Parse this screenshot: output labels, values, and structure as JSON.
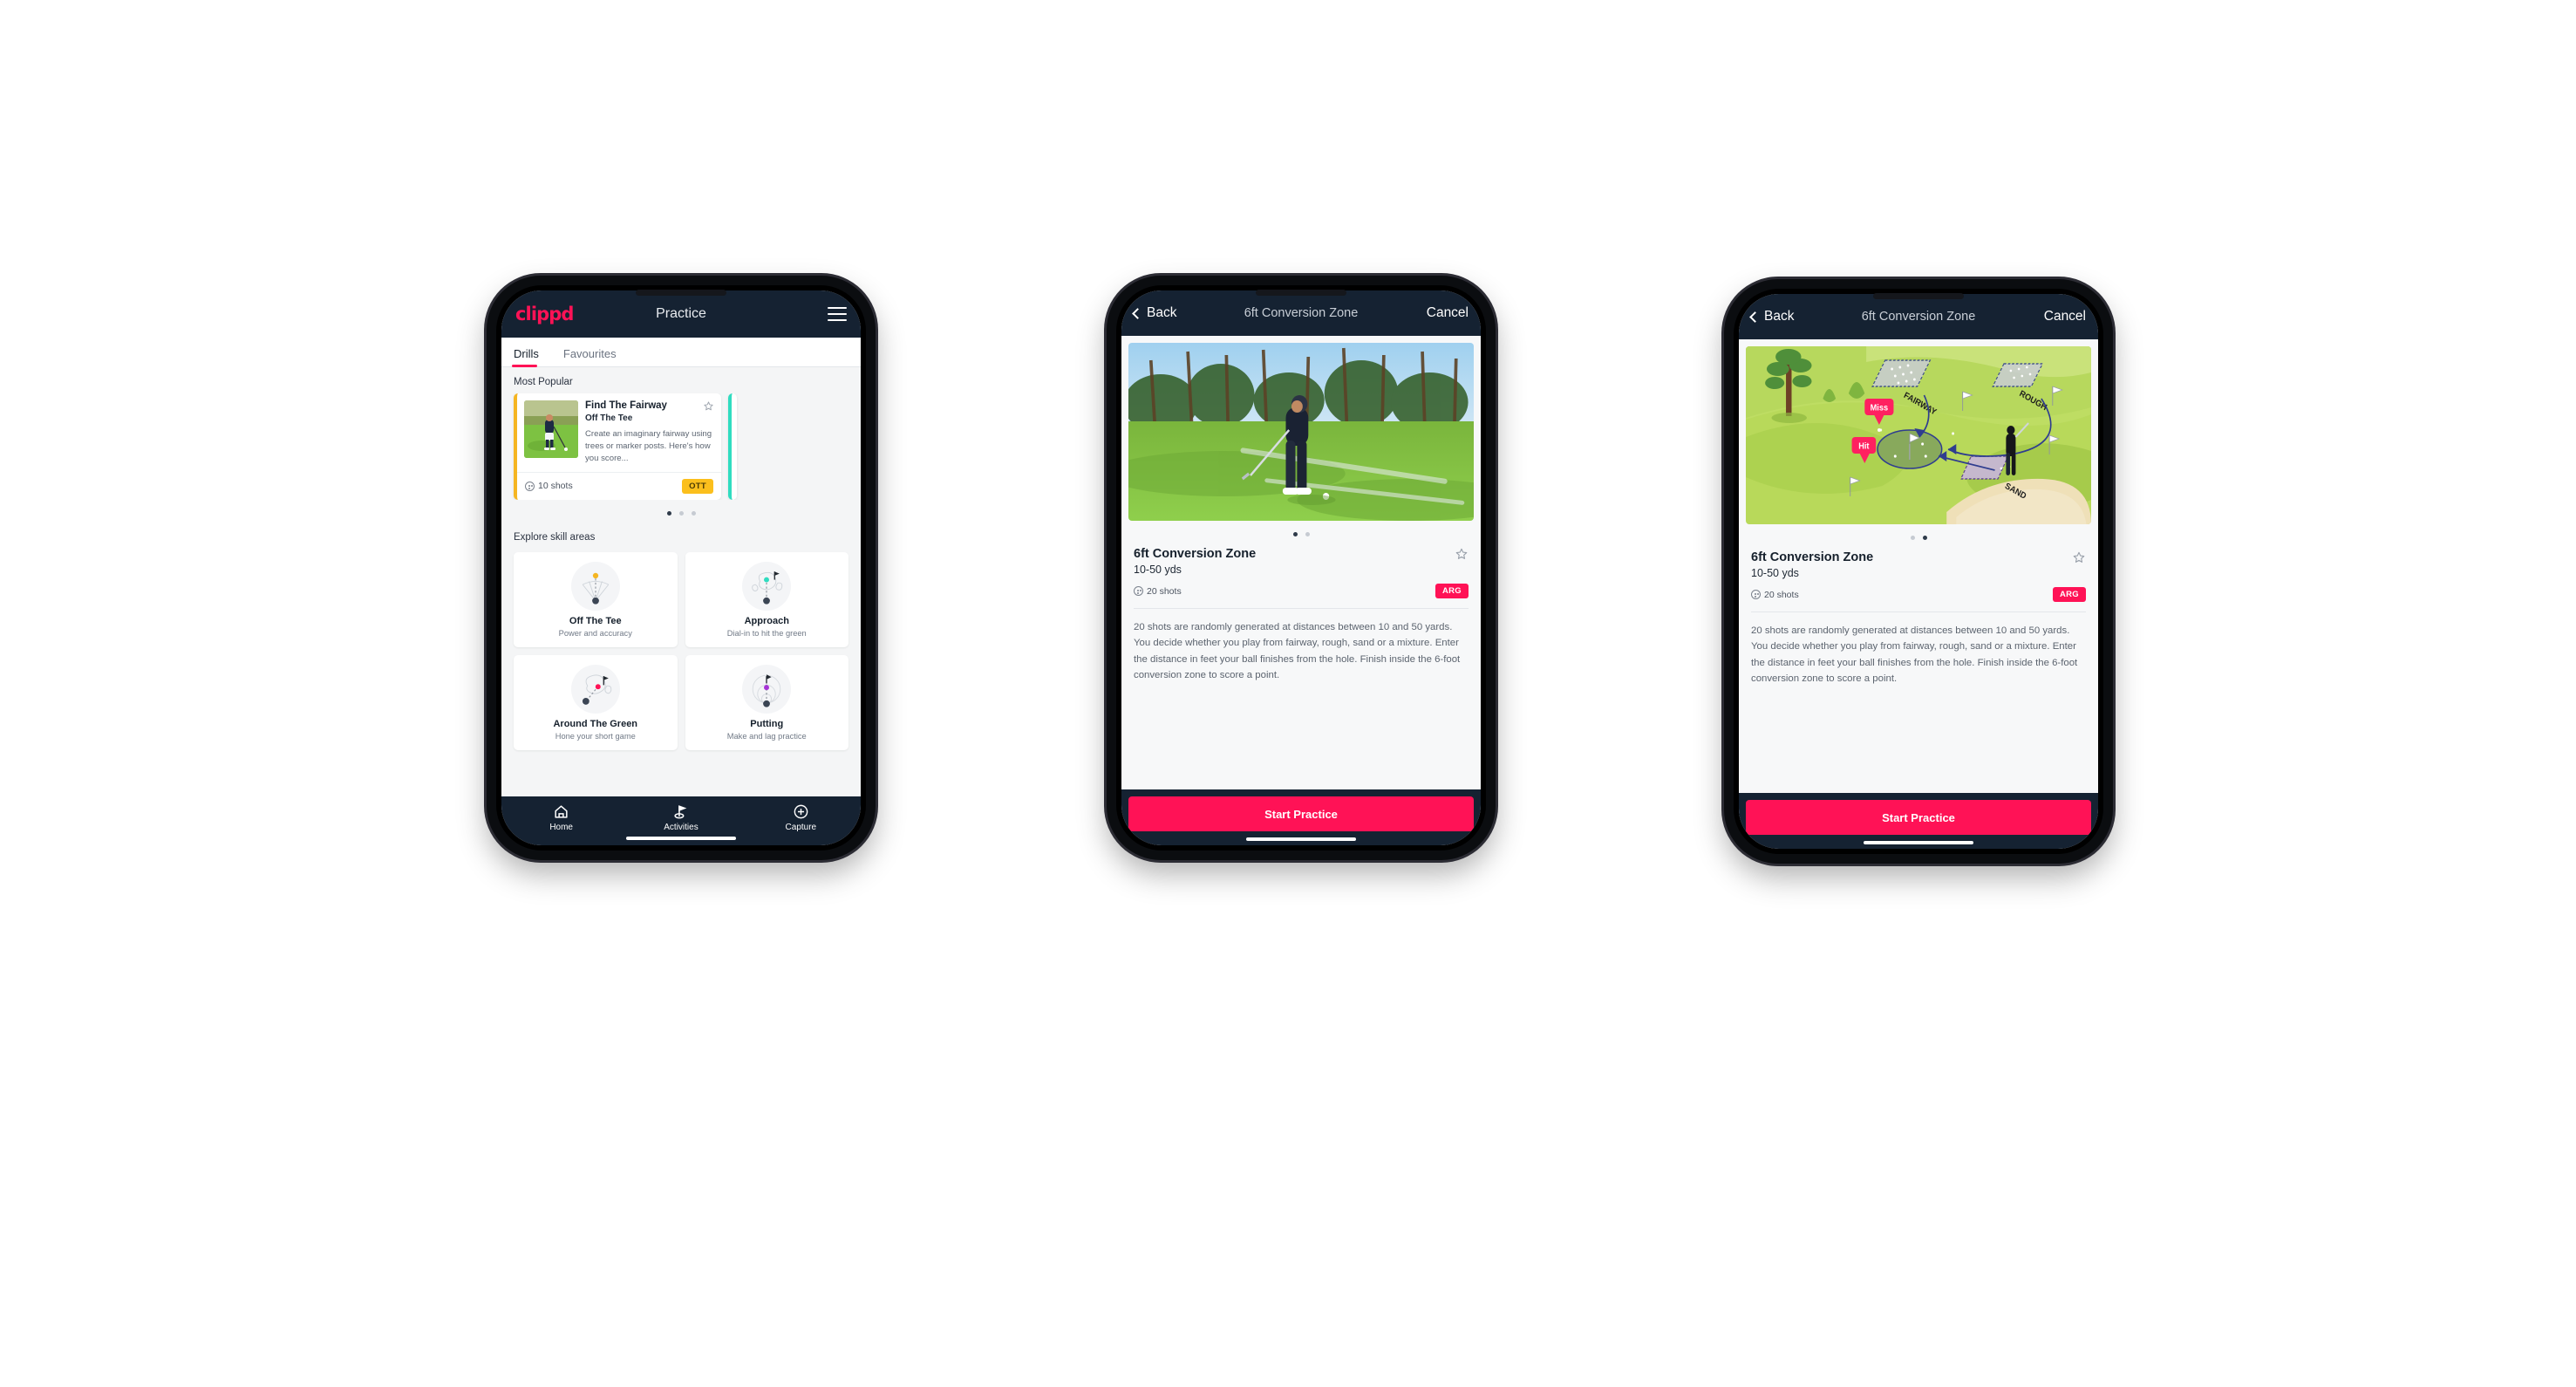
{
  "phone1": {
    "appbar": {
      "logo": "clippd",
      "title": "Practice",
      "menu_icon": "hamburger-icon"
    },
    "tabs": [
      {
        "label": "Drills",
        "active": true
      },
      {
        "label": "Favourites",
        "active": false
      }
    ],
    "sections": {
      "most_popular": "Most Popular",
      "explore": "Explore skill areas"
    },
    "drill_card": {
      "title": "Find The Fairway",
      "subtitle": "Off The Tee",
      "description": "Create an imaginary fairway using trees or marker posts. Here's how you score...",
      "shots": "10 shots",
      "badge": "OTT",
      "accent": "#f5b521",
      "next_accent": "#2fdcc0",
      "star_icon": "star-outline-icon"
    },
    "carousel_dots": {
      "count": 3,
      "active": 0
    },
    "skill_areas": [
      {
        "name": "Off The Tee",
        "desc": "Power and accuracy",
        "icon": "tee-fan-icon",
        "accent": "#f5b521"
      },
      {
        "name": "Approach",
        "desc": "Dial-in to hit the green",
        "icon": "green-target-icon",
        "accent": "#2fdcc0"
      },
      {
        "name": "Around The Green",
        "desc": "Hone your short game",
        "icon": "chip-icon",
        "accent": "#ff1256"
      },
      {
        "name": "Putting",
        "desc": "Make and lag practice",
        "icon": "putt-rings-icon",
        "accent": "#a633d6"
      }
    ],
    "tabbar": [
      {
        "label": "Home",
        "icon": "home-icon",
        "active": false
      },
      {
        "label": "Activities",
        "icon": "golf-flag-icon",
        "active": true
      },
      {
        "label": "Capture",
        "icon": "plus-circle-icon",
        "active": false
      }
    ]
  },
  "phone2": {
    "nav": {
      "back": "Back",
      "title": "6ft Conversion Zone",
      "cancel": "Cancel",
      "back_icon": "chevron-left-icon"
    },
    "media": "golfer-chipping-photo",
    "dots": {
      "count": 2,
      "active": 0
    },
    "detail": {
      "title": "6ft Conversion Zone",
      "yards": "10-50 yds",
      "shots": "20 shots",
      "badge": "ARG",
      "star_icon": "star-outline-icon",
      "description": "20 shots are randomly generated at distances between 10 and 50 yards. You decide whether you play from fairway, rough, sand or a mixture. Enter the distance in feet your ball finishes from the hole. Finish inside the 6-foot conversion zone to score a point."
    },
    "cta": "Start Practice"
  },
  "phone3": {
    "nav": {
      "back": "Back",
      "title": "6ft Conversion Zone",
      "cancel": "Cancel",
      "back_icon": "chevron-left-icon"
    },
    "media": "course-diagram-illustration",
    "diagram_labels": {
      "fairway": "FAIRWAY",
      "rough": "ROUGH",
      "sand": "SAND",
      "miss": "Miss",
      "hit": "Hit"
    },
    "dots": {
      "count": 2,
      "active": 1
    },
    "detail": {
      "title": "6ft Conversion Zone",
      "yards": "10-50 yds",
      "shots": "20 shots",
      "badge": "ARG",
      "star_icon": "star-outline-icon",
      "description": "20 shots are randomly generated at distances between 10 and 50 yards. You decide whether you play from fairway, rough, sand or a mixture. Enter the distance in feet your ball finishes from the hole. Finish inside the 6-foot conversion zone to score a point."
    },
    "cta": "Start Practice"
  },
  "colors": {
    "brand": "#ff1256",
    "dark": "#152232",
    "amber": "#fbbf1d",
    "teal": "#2fdcc0"
  }
}
